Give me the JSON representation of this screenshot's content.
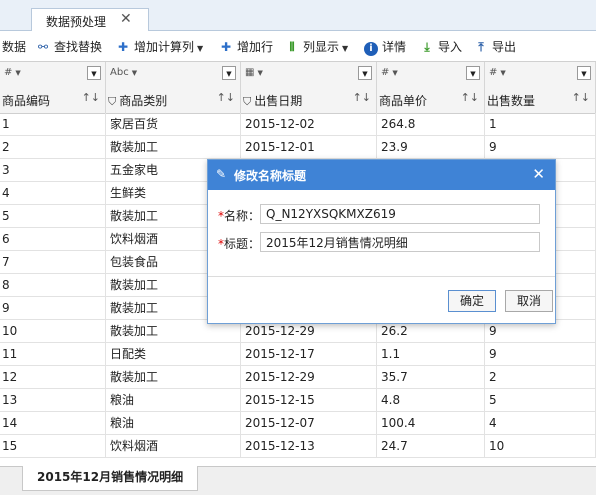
{
  "doc_tab": {
    "label": "数据预处理",
    "close": "✕"
  },
  "toolbar": {
    "items": [
      {
        "label": "数据",
        "icon": ""
      },
      {
        "label": "查找替换",
        "icon": "binoculars-icon"
      },
      {
        "label": "增加计算列",
        "icon": "plus-icon"
      },
      {
        "label": "增加行",
        "icon": "plus-icon"
      },
      {
        "label": "列显示",
        "icon": "columns-icon"
      },
      {
        "label": "详情",
        "icon": "info-icon"
      },
      {
        "label": "导入",
        "icon": "import-icon"
      },
      {
        "label": "导出",
        "icon": "export-icon"
      }
    ]
  },
  "columns": [
    {
      "type": "#",
      "name": "商品编码",
      "type_icon": "number-icon"
    },
    {
      "type": "Abc",
      "name": "商品类别",
      "type_icon": "text-icon"
    },
    {
      "type": "",
      "name": "出售日期",
      "type_icon": "calendar-icon"
    },
    {
      "type": "#",
      "name": "商品单价",
      "type_icon": "number-icon"
    },
    {
      "type": "#",
      "name": "出售数量",
      "type_icon": "number-icon"
    }
  ],
  "rows": [
    [
      "1",
      "家居百货",
      "2015-12-02",
      "264.8",
      "1"
    ],
    [
      "2",
      "散装加工",
      "2015-12-01",
      "23.9",
      "9"
    ],
    [
      "3",
      "五金家电",
      "",
      "",
      ""
    ],
    [
      "4",
      "生鲜类",
      "",
      "",
      ""
    ],
    [
      "5",
      "散装加工",
      "",
      "",
      ""
    ],
    [
      "6",
      "饮料烟酒",
      "",
      "",
      ""
    ],
    [
      "7",
      "包装食品",
      "",
      "",
      ""
    ],
    [
      "8",
      "散装加工",
      "",
      "",
      ""
    ],
    [
      "9",
      "散装加工",
      "",
      "",
      ""
    ],
    [
      "10",
      "散装加工",
      "2015-12-29",
      "26.2",
      "9"
    ],
    [
      "11",
      "日配类",
      "2015-12-17",
      "1.1",
      "9"
    ],
    [
      "12",
      "散装加工",
      "2015-12-29",
      "35.7",
      "2"
    ],
    [
      "13",
      "粮油",
      "2015-12-15",
      "4.8",
      "5"
    ],
    [
      "14",
      "粮油",
      "2015-12-07",
      "100.4",
      "4"
    ],
    [
      "15",
      "饮料烟酒",
      "2015-12-13",
      "24.7",
      "10"
    ]
  ],
  "sheet_tab": {
    "label": "2015年12月销售情况明细"
  },
  "dialog": {
    "title": "修改名称标题",
    "name_label": "名称：",
    "name_value": "Q_N12YXSQKMXZ619",
    "title_label": "标题：",
    "title_value": "2015年12月销售情况明细",
    "ok_label": "确定",
    "cancel_label": "取消",
    "required_mark": "*"
  },
  "colors": {
    "dialog_header": "#3f83d6",
    "tab_bar": "#e9f0f8"
  }
}
